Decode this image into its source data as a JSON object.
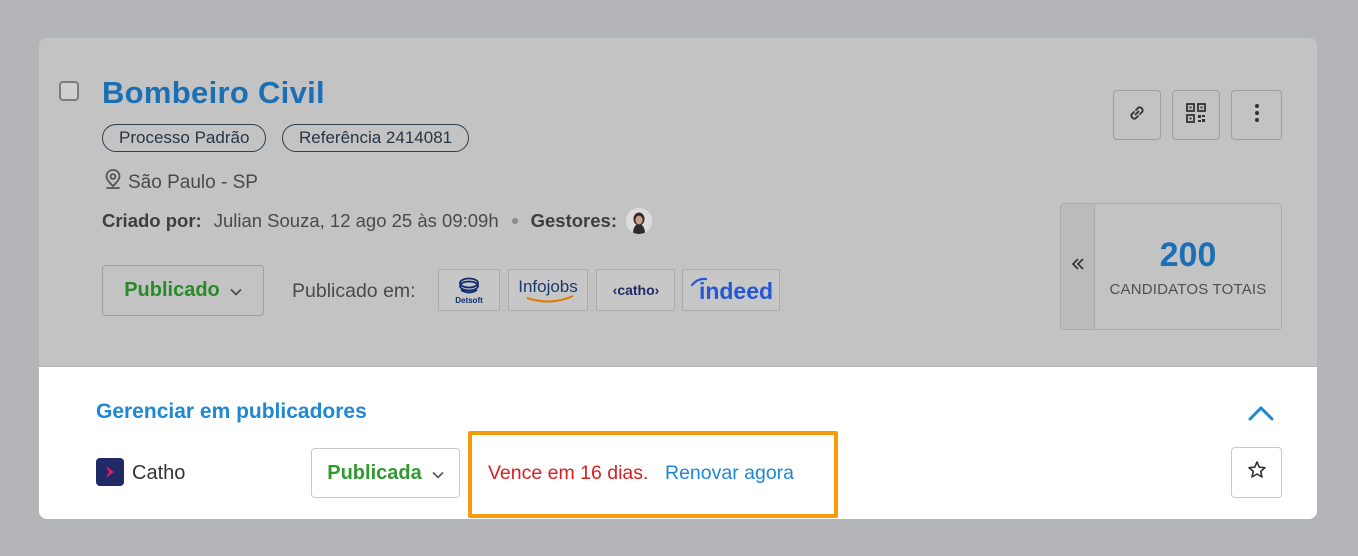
{
  "job": {
    "title": "Bombeiro Civil",
    "tags": [
      "Processo Padrão",
      "Referência 2414081"
    ],
    "location": "São Paulo - SP",
    "created_by_label": "Criado por:",
    "created_by_value": "Julian Souza, 12 ago 25 às 09:09h",
    "managers_label": "Gestores:",
    "status": "Publicado",
    "published_in_label": "Publicado em:",
    "publishers": [
      {
        "name": "Detsoft",
        "icon": "detsoft-logo"
      },
      {
        "name": "Infojobs",
        "icon": "infojobs-logo"
      },
      {
        "name": "‹catho›",
        "icon": "catho-logo"
      },
      {
        "name": "indeed",
        "icon": "indeed-logo"
      }
    ]
  },
  "actions": {
    "icons": [
      "link-icon",
      "qr-code-icon",
      "more-vertical-icon"
    ]
  },
  "counter": {
    "value": "200",
    "label": "CANDIDATOS TOTAIS"
  },
  "manage": {
    "title": "Gerenciar em publicadores",
    "publisher_name": "Catho",
    "status": "Publicada",
    "expires": "Vence em 16 dias.",
    "renew": "Renovar agora"
  },
  "colors": {
    "accent": "#1b6fb5",
    "link": "#1e88d4",
    "success": "#2a8a2a",
    "danger": "#d62020",
    "highlight": "#f59b0c"
  }
}
